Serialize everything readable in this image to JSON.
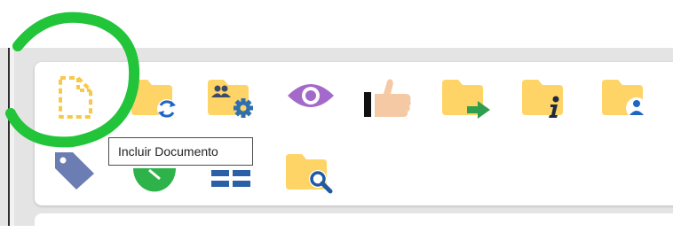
{
  "tooltip": {
    "text": "Incluir Documento"
  },
  "toolbar": {
    "row1": [
      {
        "name": "include-document-button",
        "icon": "document-dashed-icon",
        "color": "#f7c948"
      },
      {
        "name": "folder-sync-button",
        "icon": "folder-sync-icon",
        "color": "#ffd466"
      },
      {
        "name": "folder-users-settings-button",
        "icon": "folder-users-gear-icon",
        "color": "#ffd466"
      },
      {
        "name": "view-button",
        "icon": "eye-icon",
        "color": "#a46acb"
      },
      {
        "name": "sign-button",
        "icon": "thumbs-up-icon",
        "color": "#f5c9a4"
      },
      {
        "name": "send-process-button",
        "icon": "folder-arrow-icon",
        "color": "#ffd466"
      },
      {
        "name": "process-info-button",
        "icon": "folder-info-icon",
        "color": "#ffd466"
      },
      {
        "name": "folder-user-button",
        "icon": "folder-user-icon",
        "color": "#ffd466"
      }
    ],
    "row2": [
      {
        "name": "tag-button",
        "icon": "tag-icon",
        "color": "#6b7db3"
      },
      {
        "name": "deadline-button",
        "icon": "clock-icon",
        "color": "#2db34a"
      },
      {
        "name": "list-button",
        "icon": "equals-icon",
        "color": "#2b5fa8"
      },
      {
        "name": "search-folder-button",
        "icon": "folder-search-icon",
        "color": "#ffd466"
      }
    ]
  },
  "colors": {
    "highlight": "#22c43a",
    "folder": "#ffd466",
    "accent_blue": "#1f66c4"
  }
}
